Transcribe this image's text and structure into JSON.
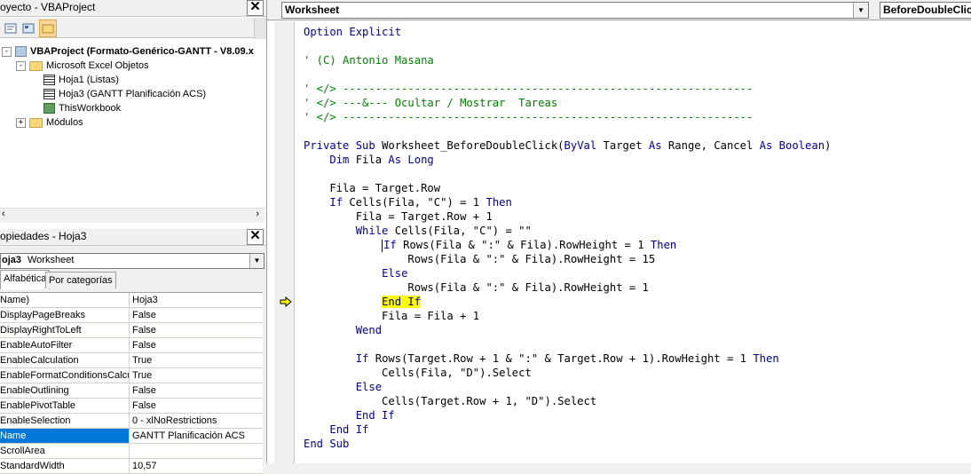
{
  "project_panel": {
    "title": "oyecto - VBAProject",
    "tree": [
      {
        "label": "VBAProject (Formato-Genérico-GANTT - V8.09.x",
        "kind": "project",
        "expander": "-",
        "level": 0,
        "bold": true
      },
      {
        "label": "Microsoft Excel Objetos",
        "kind": "folder",
        "expander": "-",
        "level": 1
      },
      {
        "label": "Hoja1 (Listas)",
        "kind": "sheet",
        "level": 2
      },
      {
        "label": "Hoja3 (GANTT Planificación ACS)",
        "kind": "sheet",
        "level": 2
      },
      {
        "label": "ThisWorkbook",
        "kind": "workbook",
        "level": 2
      },
      {
        "label": "Módulos",
        "kind": "folder",
        "expander": "+",
        "level": 1
      }
    ]
  },
  "properties_panel": {
    "title": "opiedades - Hoja3",
    "object_combo": {
      "name": "oja3",
      "type": "Worksheet"
    },
    "tabs": [
      "Alfabética",
      "Por categorías"
    ],
    "active_tab": "Alfabética",
    "rows": [
      {
        "name": "Name)",
        "value": "Hoja3"
      },
      {
        "name": "DisplayPageBreaks",
        "value": "False"
      },
      {
        "name": "DisplayRightToLeft",
        "value": "False"
      },
      {
        "name": "EnableAutoFilter",
        "value": "False"
      },
      {
        "name": "EnableCalculation",
        "value": "True"
      },
      {
        "name": "EnableFormatConditionsCalcula",
        "value": "True"
      },
      {
        "name": "EnableOutlining",
        "value": "False"
      },
      {
        "name": "EnablePivotTable",
        "value": "False"
      },
      {
        "name": "EnableSelection",
        "value": "0 - xlNoRestrictions"
      },
      {
        "name": "Name",
        "value": "GANTT Planificación ACS",
        "selected": true
      },
      {
        "name": "ScrollArea",
        "value": ""
      },
      {
        "name": "StandardWidth",
        "value": "10,57"
      }
    ]
  },
  "code_window": {
    "object_combo": "Worksheet",
    "procedure_combo": "BeforeDoubleClick",
    "lines": [
      [
        {
          "t": "Option Explicit",
          "c": "kw"
        }
      ],
      [],
      [
        {
          "t": "' (C) Antonio Masana",
          "c": "cm"
        }
      ],
      [],
      [
        {
          "t": "' </> ---------------------------------------------------------------",
          "c": "cm"
        }
      ],
      [
        {
          "t": "' </> ---&--- Ocultar / Mostrar  Tareas",
          "c": "cm"
        }
      ],
      [
        {
          "t": "' </> ---------------------------------------------------------------",
          "c": "cm"
        }
      ],
      [],
      [
        {
          "t": "Private Sub ",
          "c": "kw"
        },
        {
          "t": "Worksheet_BeforeDoubleClick("
        },
        {
          "t": "ByVal",
          "c": "kw"
        },
        {
          "t": " Target "
        },
        {
          "t": "As",
          "c": "kw"
        },
        {
          "t": " Range, Cancel "
        },
        {
          "t": "As Boolean",
          "c": "kw"
        },
        {
          "t": ")"
        }
      ],
      [
        {
          "t": "    "
        },
        {
          "t": "Dim",
          "c": "kw"
        },
        {
          "t": " Fila "
        },
        {
          "t": "As Long",
          "c": "kw"
        }
      ],
      [],
      [
        {
          "t": "    Fila = Target.Row"
        }
      ],
      [
        {
          "t": "    "
        },
        {
          "t": "If",
          "c": "kw"
        },
        {
          "t": " Cells(Fila, \"C\") = 1 "
        },
        {
          "t": "Then",
          "c": "kw"
        }
      ],
      [
        {
          "t": "        Fila = Target.Row + 1"
        }
      ],
      [
        {
          "t": "        "
        },
        {
          "t": "While",
          "c": "kw"
        },
        {
          "t": " Cells(Fila, \"C\") = \"\""
        }
      ],
      [
        {
          "t": "            ",
          "caret": true
        },
        {
          "t": "If",
          "c": "kw"
        },
        {
          "t": " Rows(Fila & \":\" & Fila).RowHeight = 1 "
        },
        {
          "t": "Then",
          "c": "kw"
        }
      ],
      [
        {
          "t": "                Rows(Fila & \":\" & Fila).RowHeight = 15"
        }
      ],
      [
        {
          "t": "            "
        },
        {
          "t": "Else",
          "c": "kw"
        }
      ],
      [
        {
          "t": "                Rows(Fila & \":\" & Fila).RowHeight = 1"
        }
      ],
      [
        {
          "t": "            "
        },
        {
          "t": "End If",
          "c": "kw hl"
        }
      ],
      [
        {
          "t": "            Fila = Fila + 1"
        }
      ],
      [
        {
          "t": "        "
        },
        {
          "t": "Wend",
          "c": "kw"
        }
      ],
      [],
      [
        {
          "t": "        "
        },
        {
          "t": "If",
          "c": "kw"
        },
        {
          "t": " Rows(Target.Row + 1 & \":\" & Target.Row + 1).RowHeight = 1 "
        },
        {
          "t": "Then",
          "c": "kw"
        }
      ],
      [
        {
          "t": "            Cells(Fila, \"D\").Select"
        }
      ],
      [
        {
          "t": "        "
        },
        {
          "t": "Else",
          "c": "kw"
        }
      ],
      [
        {
          "t": "            Cells(Target.Row + 1, \"D\").Select"
        }
      ],
      [
        {
          "t": "        "
        },
        {
          "t": "End If",
          "c": "kw"
        }
      ],
      [
        {
          "t": "    "
        },
        {
          "t": "End If",
          "c": "kw"
        }
      ],
      [
        {
          "t": "End Sub",
          "c": "kw"
        }
      ]
    ]
  },
  "colors": {
    "keyword": "#00008b",
    "comment": "#008000",
    "highlight": "#ffff00",
    "selection": "#0078d7"
  },
  "icons": [
    "close-icon",
    "view-code-icon",
    "view-object-icon",
    "toggle-folders-icon",
    "project-icon",
    "folder-icon",
    "sheet-icon",
    "workbook-icon",
    "execution-pointer-icon",
    "dropdown-arrow-icon"
  ]
}
